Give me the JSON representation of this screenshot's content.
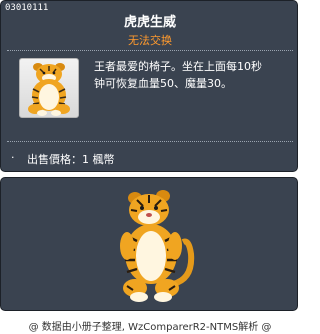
{
  "item": {
    "id": "03010111",
    "name": "虎虎生威",
    "trade_status": "无法交换",
    "description": "王者最爱的椅子。坐在上面每10秒\n钟可恢复血量50、魔量30。",
    "sell_bullet": "·",
    "sell_price": "出售價格：1 楓幣",
    "icon": "tiger-chair-icon",
    "preview": "tiger-chair-preview"
  },
  "footer": {
    "credit": "@ 数据由小册子整理, WzComparerR2-NTMS解析 @"
  },
  "colors": {
    "panel": "#3a4350",
    "trade_status": "#ff9a2e",
    "text": "#ffffff"
  }
}
